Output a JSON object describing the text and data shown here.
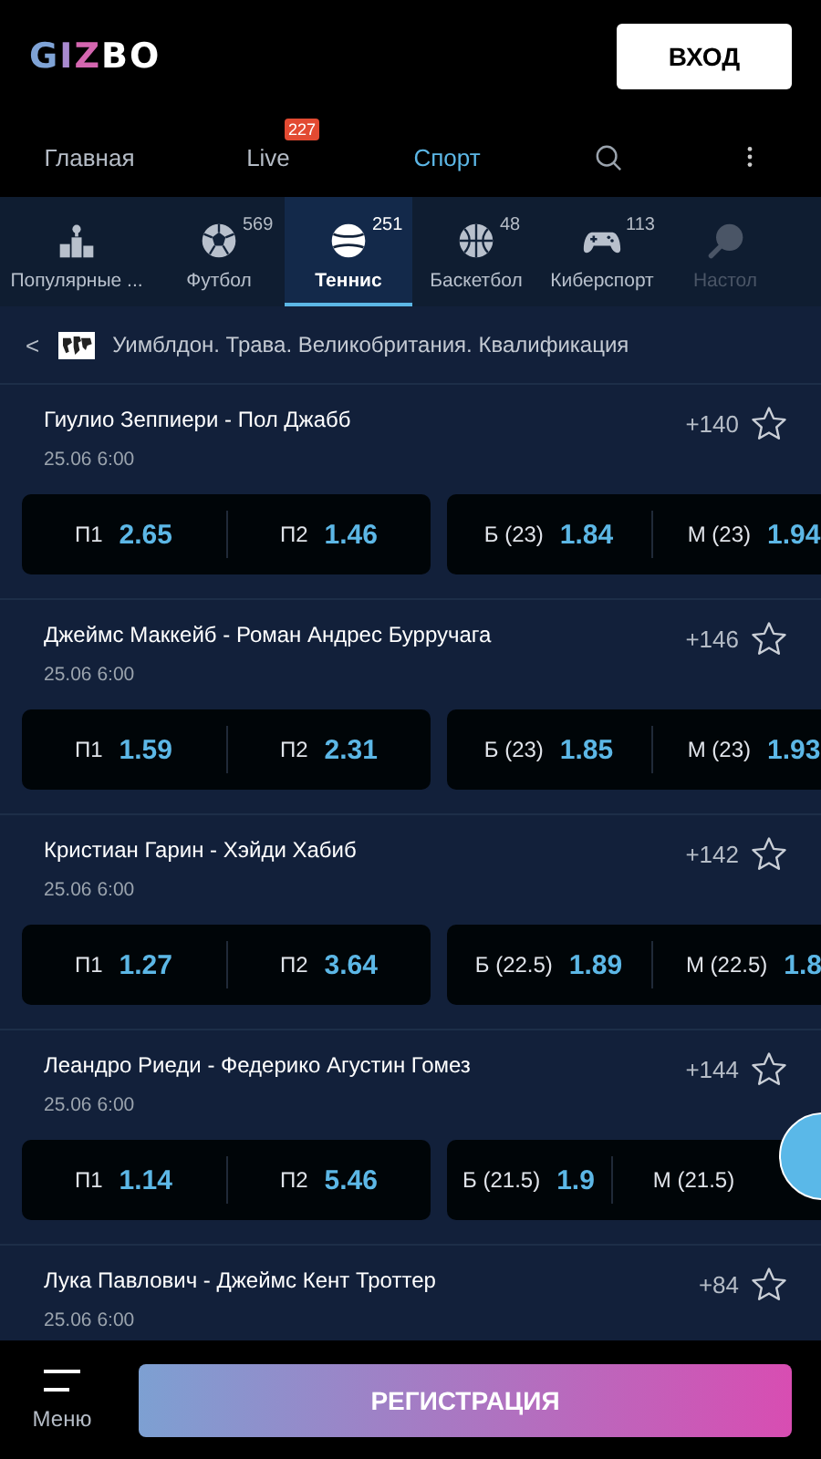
{
  "header": {
    "logo": "GIZBO",
    "login_button": "ВХОД"
  },
  "nav": [
    {
      "label": "Главная",
      "selected": false
    },
    {
      "label": "Live",
      "selected": false,
      "badge": "227"
    },
    {
      "label": "Спорт",
      "selected": true
    }
  ],
  "sports": [
    {
      "label": "Популярные ...",
      "selected": false
    },
    {
      "label": "Футбол",
      "count": "569",
      "selected": false
    },
    {
      "label": "Теннис",
      "count": "251",
      "selected": true
    },
    {
      "label": "Баскетбол",
      "count": "48",
      "selected": false
    },
    {
      "label": "Киберспорт",
      "count": "113",
      "selected": false
    },
    {
      "label": "Настол",
      "selected": false
    }
  ],
  "breadcrumb": {
    "back": "<",
    "title": "Уимблдон. Трава. Великобритания. Квалификация"
  },
  "matches": [
    {
      "title": "Гиулио Зеппиери - Пол Джабб",
      "date": "25.06 6:00",
      "more": "+140",
      "markets": [
        [
          {
            "label": "П1",
            "odds": "2.65"
          },
          {
            "label": "П2",
            "odds": "1.46"
          }
        ],
        [
          {
            "label": "Б (23)",
            "odds": "1.84"
          },
          {
            "label": "М (23)",
            "odds": "1.94"
          }
        ]
      ]
    },
    {
      "title": "Джеймс Маккейб - Роман Андрес Бурручага",
      "date": "25.06 6:00",
      "more": "+146",
      "markets": [
        [
          {
            "label": "П1",
            "odds": "1.59"
          },
          {
            "label": "П2",
            "odds": "2.31"
          }
        ],
        [
          {
            "label": "Б (23)",
            "odds": "1.85"
          },
          {
            "label": "М (23)",
            "odds": "1.93"
          }
        ]
      ]
    },
    {
      "title": "Кристиан Гарин - Хэйди Хабиб",
      "date": "25.06 6:00",
      "more": "+142",
      "markets": [
        [
          {
            "label": "П1",
            "odds": "1.27"
          },
          {
            "label": "П2",
            "odds": "3.64"
          }
        ],
        [
          {
            "label": "Б (22.5)",
            "odds": "1.89"
          },
          {
            "label": "М (22.5)",
            "odds": "1.8"
          }
        ]
      ]
    },
    {
      "title": "Леандро Риеди - Федерико Агустин Гомез",
      "date": "25.06 6:00",
      "more": "+144",
      "markets": [
        [
          {
            "label": "П1",
            "odds": "1.14"
          },
          {
            "label": "П2",
            "odds": "5.46"
          }
        ],
        [
          {
            "label": "Б (21.5)",
            "odds": "1.9"
          },
          {
            "label": "М (21.5)"
          }
        ]
      ]
    },
    {
      "title": "Лука Павлович - Джеймс Кент Троттер",
      "date": "25.06 6:00",
      "more": "+84"
    }
  ],
  "bottom": {
    "menu_label": "Меню",
    "register_button": "РЕГИСТРАЦИЯ"
  }
}
